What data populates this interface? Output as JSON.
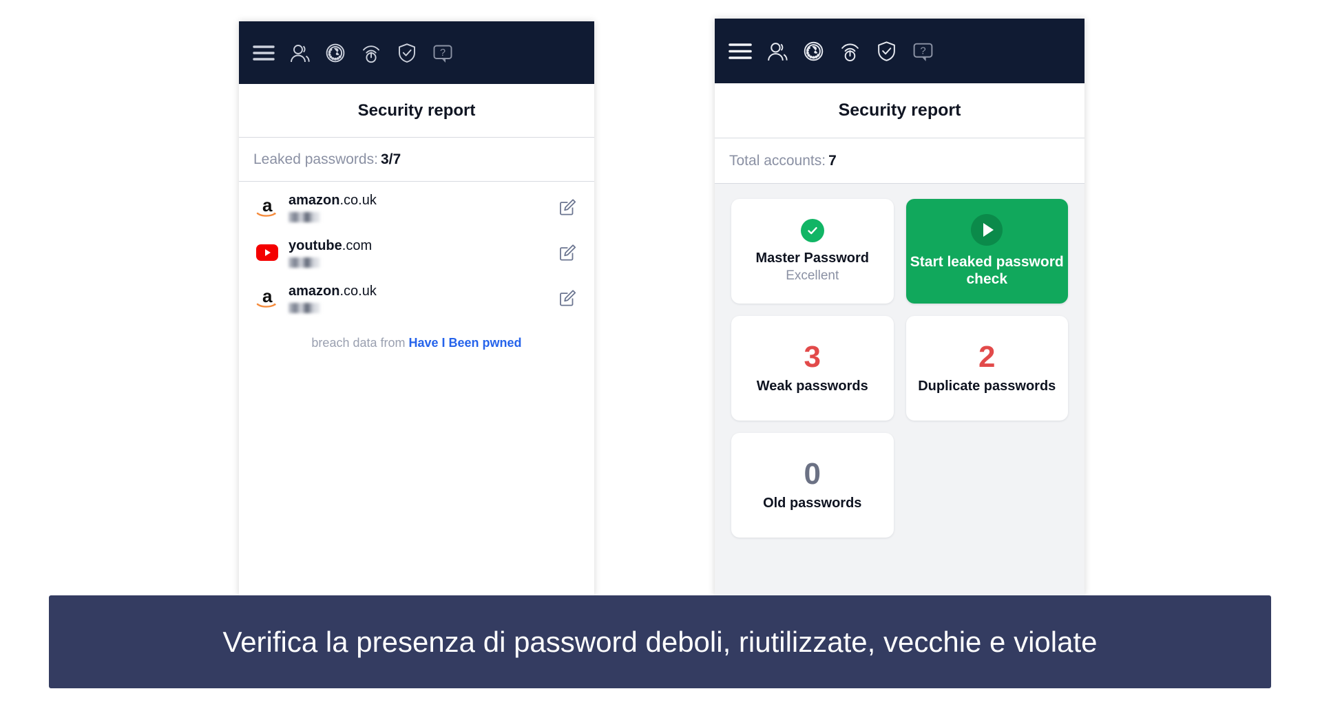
{
  "toolbar": {
    "icons": [
      {
        "name": "hamburger-menu-icon",
        "label": "Menu"
      },
      {
        "name": "user-account-icon",
        "label": "Account"
      },
      {
        "name": "globe-browsing-icon",
        "label": "Safe browsing"
      },
      {
        "name": "wifi-power-icon",
        "label": "VPN"
      },
      {
        "name": "shield-check-icon",
        "label": "Protection"
      },
      {
        "name": "help-bubble-icon",
        "label": "Help"
      }
    ]
  },
  "left_panel": {
    "title": "Security report",
    "summary_label": "Leaked passwords:",
    "summary_value": "3/7",
    "rows": [
      {
        "brand": "amazon-logo-icon",
        "name": "amazon",
        "tld": ".co.uk",
        "password_masked": "",
        "edit": "edit-icon"
      },
      {
        "brand": "youtube-logo-icon",
        "name": "youtube",
        "tld": ".com",
        "password_masked": "",
        "edit": "edit-icon"
      },
      {
        "brand": "amazon-logo-icon",
        "name": "amazon",
        "tld": ".co.uk",
        "password_masked": "",
        "edit": "edit-icon"
      }
    ],
    "breach_prefix": "breach data from ",
    "breach_link": "Have I Been pwned"
  },
  "right_panel": {
    "title": "Security report",
    "summary_label": "Total accounts:",
    "summary_value": "7",
    "cards": [
      {
        "kind": "status",
        "icon": "check-circle-icon",
        "label": "Master Password",
        "sub": "Excellent"
      },
      {
        "kind": "action",
        "icon": "play-circle-icon",
        "label": "Start leaked password check"
      },
      {
        "kind": "metric",
        "number": "3",
        "label": "Weak passwords",
        "color": "#e24a4a"
      },
      {
        "kind": "metric",
        "number": "2",
        "label": "Duplicate passwords",
        "color": "#e24a4a"
      },
      {
        "kind": "metric",
        "number": "0",
        "label": "Old passwords",
        "color": "#6b7184"
      }
    ]
  },
  "caption": {
    "text": "Verifica la presenza di password deboli, riutilizzate, vecchie e violate"
  },
  "colors": {
    "toolbar_bg": "#101b33",
    "accent_green": "#11a85c",
    "danger_red": "#e24a4a",
    "caption_bg": "#343c61",
    "link_blue": "#2563eb",
    "muted_text": "#8a90a3"
  }
}
